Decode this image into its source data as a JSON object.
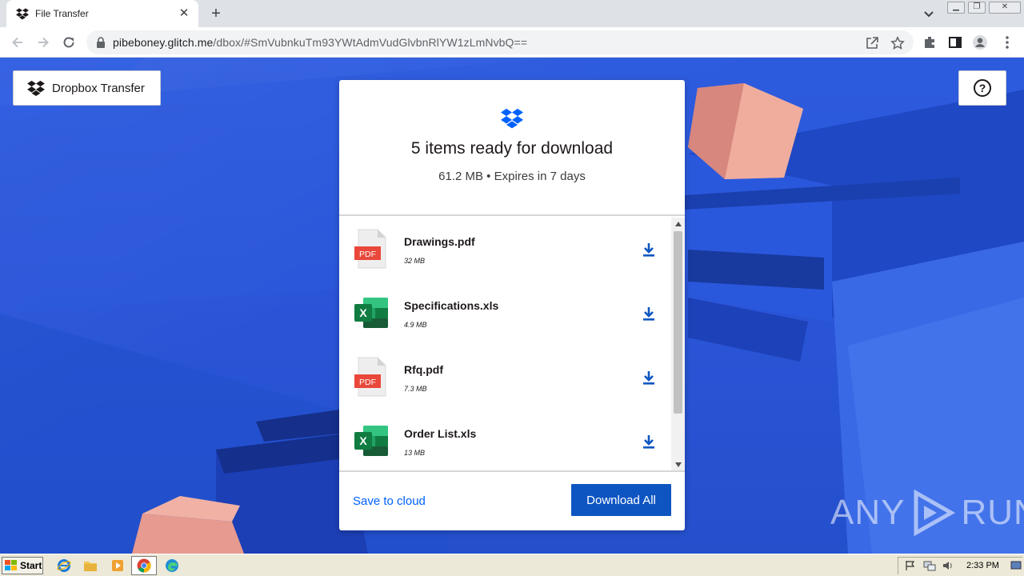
{
  "browser": {
    "tab_title": "File Transfer",
    "tab_close": "✕",
    "new_tab": "+",
    "url_host": "pibeboney.glitch.me",
    "url_path": "/dbox/#SmVubnkuTm93YWtAdmVudGlvbnRlYW1zLmNvbQ=="
  },
  "page": {
    "brand_label": "Dropbox Transfer",
    "help_label": "?",
    "title": "5 items ready for download",
    "subtitle": "61.2 MB • Expires in 7 days",
    "files": [
      {
        "name": "Drawings.pdf",
        "size": "32 MB",
        "type": "pdf",
        "badge": "PDF"
      },
      {
        "name": "Specifications.xls",
        "size": "4.9 MB",
        "type": "xls",
        "badge": "X"
      },
      {
        "name": "Rfq.pdf",
        "size": "7.3 MB",
        "type": "pdf",
        "badge": "PDF"
      },
      {
        "name": "Order List.xls",
        "size": "13 MB",
        "type": "xls",
        "badge": "X"
      }
    ],
    "save_to_cloud": "Save to cloud",
    "download_all": "Download All",
    "watermark_left": "ANY",
    "watermark_right": "RUN"
  },
  "taskbar": {
    "start_label": "Start",
    "clock": "2:33 PM"
  },
  "colors": {
    "dropbox_blue": "#0061fe",
    "button_blue": "#0f55c2",
    "pdf_red": "#e9483b",
    "excel_green": "#1f7244",
    "background_blue": "#2a55d8",
    "cube_pink": "#e79a8f"
  }
}
